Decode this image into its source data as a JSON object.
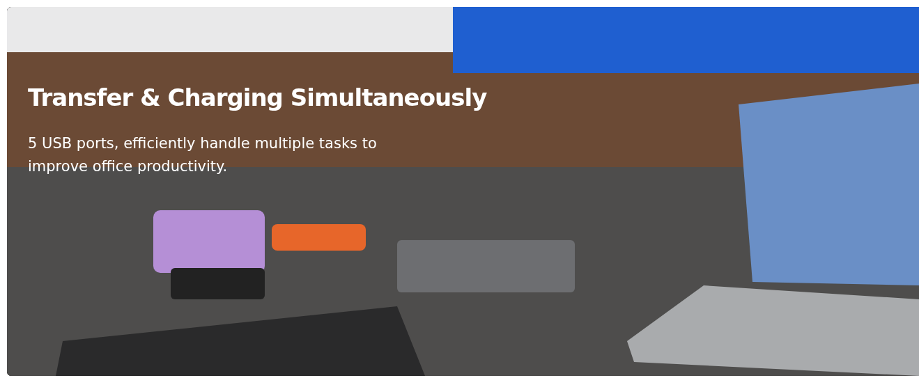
{
  "banner": {
    "heading": "Transfer & Charging Simultaneously",
    "description": "5 USB ports, efficiently handle multiple tasks to improve office productivity."
  }
}
